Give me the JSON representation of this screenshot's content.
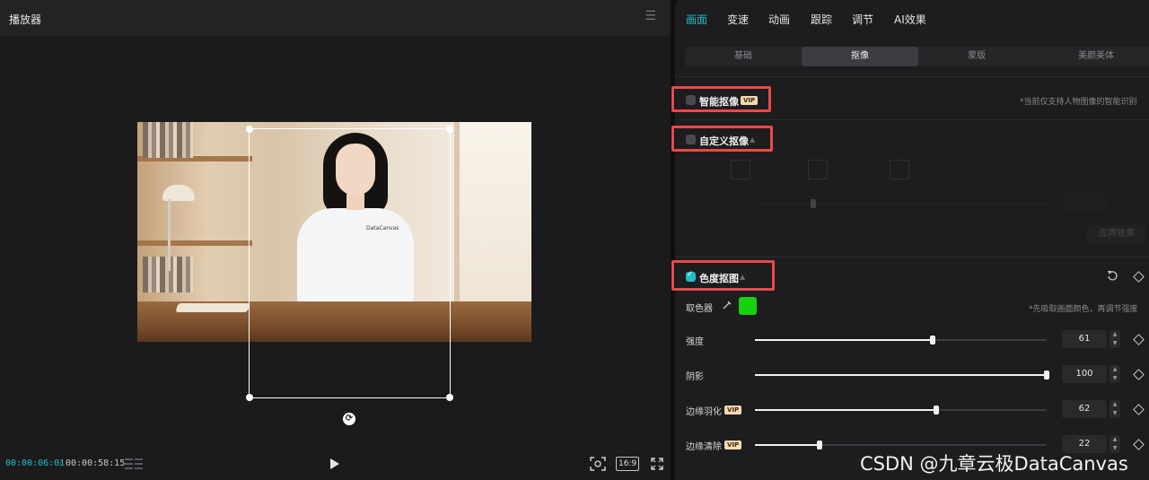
{
  "player": {
    "title": "播放器",
    "time_current": "00:00:06:01",
    "time_separator": "/",
    "time_total": "00:00:58:15",
    "ratio": "16:9",
    "shirt_text": "DataCanvas"
  },
  "properties": {
    "tabs": [
      {
        "label": "画面",
        "active": true
      },
      {
        "label": "变速",
        "active": false
      },
      {
        "label": "动画",
        "active": false
      },
      {
        "label": "跟踪",
        "active": false
      },
      {
        "label": "调节",
        "active": false
      },
      {
        "label": "AI效果",
        "active": false
      }
    ],
    "subtabs": [
      {
        "label": "基础",
        "active": false
      },
      {
        "label": "抠像",
        "active": true
      },
      {
        "label": "蒙版",
        "active": false
      },
      {
        "label": "美颜美体",
        "active": false
      }
    ],
    "smart_cutout": {
      "label": "智能抠像",
      "vip": "VIP",
      "checked": false,
      "note": "*当前仅支持人物图像的智能识别"
    },
    "custom_cutout": {
      "label": "自定义抠像",
      "checked": false,
      "apply_button": "应用效果"
    },
    "chroma_key": {
      "label": "色度抠图",
      "checked": true,
      "picker_label": "取色器",
      "picker_color": "#16d10e",
      "note": "*先吸取画面颜色，再调节强度",
      "rows": [
        {
          "label": "强度",
          "value": 61,
          "vip": ""
        },
        {
          "label": "阴影",
          "value": 100,
          "vip": ""
        },
        {
          "label": "边缘羽化",
          "value": 62,
          "vip": "VIP"
        },
        {
          "label": "边缘清除",
          "value": 22,
          "vip": "VIP"
        }
      ]
    }
  },
  "watermark": "CSDN @九章云极DataCanvas",
  "colors": {
    "accent": "#1fbec8",
    "highlight": "#e84a4a",
    "vip_bg": "#f5d9b0"
  }
}
